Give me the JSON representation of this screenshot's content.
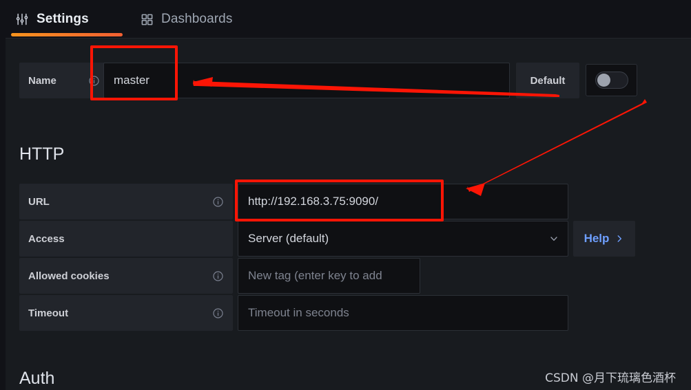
{
  "tabs": [
    {
      "label": "Settings",
      "icon": "sliders-icon",
      "active": true
    },
    {
      "label": "Dashboards",
      "icon": "grid-icon",
      "active": false
    }
  ],
  "name_row": {
    "label": "Name",
    "info_icon": "info-circle-icon",
    "value": "master",
    "default_label": "Default",
    "toggle_state": "off"
  },
  "sections": {
    "http": {
      "title": "HTTP",
      "rows": {
        "url": {
          "label": "URL",
          "info_icon": "info-circle-icon",
          "value": "http://192.168.3.75:9090/"
        },
        "access": {
          "label": "Access",
          "value": "Server (default)",
          "chevron_icon": "chevron-down-icon",
          "help_label": "Help",
          "help_icon": "chevron-right-icon"
        },
        "cookies": {
          "label": "Allowed cookies",
          "info_icon": "info-circle-icon",
          "placeholder": "New tag (enter key to add"
        },
        "timeout": {
          "label": "Timeout",
          "info_icon": "info-circle-icon",
          "placeholder": "Timeout in seconds"
        }
      }
    },
    "auth": {
      "title": "Auth"
    }
  },
  "annotations": {
    "color": "#fc1505",
    "boxes": [
      {
        "target": "name-input"
      },
      {
        "target": "url-input"
      }
    ],
    "arrows": [
      {
        "from": "default-label",
        "to": "name-input"
      },
      {
        "from": "toggle",
        "to": "url-input"
      }
    ]
  },
  "watermark": {
    "text": "CSDN @月下琉璃色酒杯"
  }
}
